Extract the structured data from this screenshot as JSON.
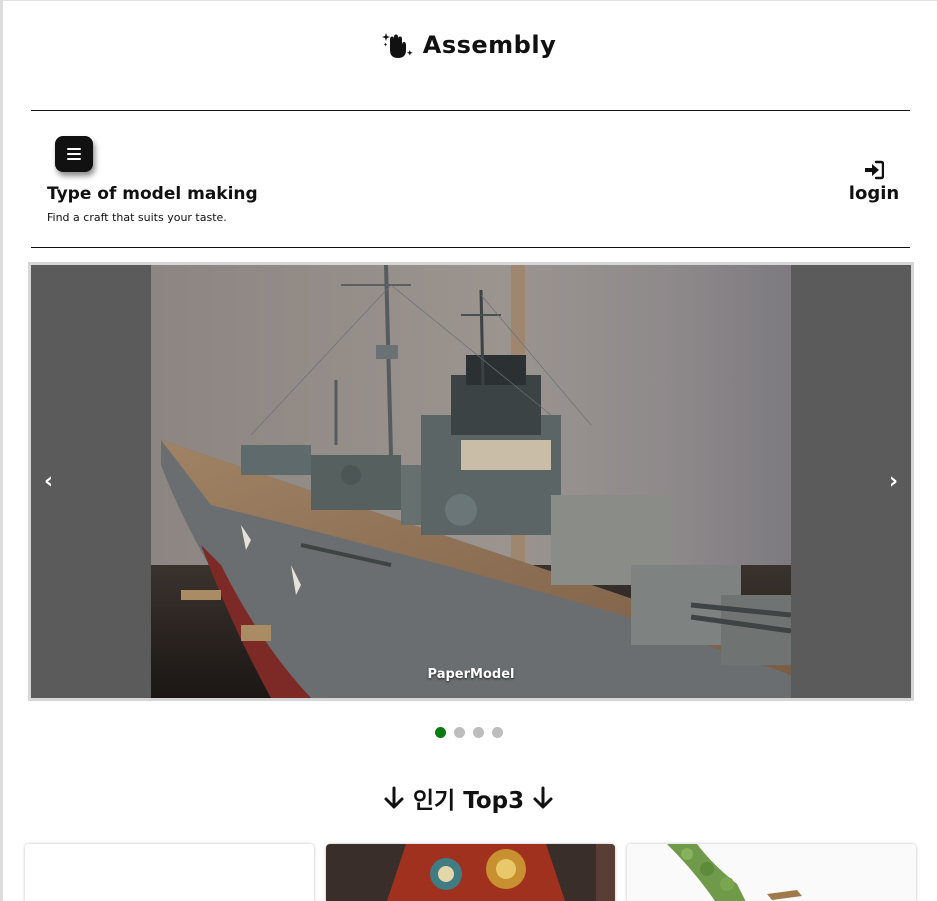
{
  "app": {
    "title": "Assembly",
    "logo_icon": "waving-hand-sparkle-icon"
  },
  "subheader": {
    "menu_icon": "menu-icon",
    "title": "Type of model making",
    "subtitle": "Find a craft that suits your taste.",
    "login_label": "login",
    "login_icon": "sign-in-icon"
  },
  "carousel": {
    "prev_label": "‹",
    "next_label": "›",
    "slides": [
      {
        "caption": "PaperModel",
        "image": "battleship-paper-model-photo"
      }
    ],
    "slide_count": 4,
    "active_index": 0,
    "active_color": "#0a7a12"
  },
  "popular": {
    "title": "인기 Top3",
    "arrow_icon": "arrow-down-icon",
    "cards": [
      {
        "image": "blank-white-image"
      },
      {
        "image": "ornate-red-model-photo"
      },
      {
        "image": "green-tree-model-photo"
      }
    ]
  }
}
